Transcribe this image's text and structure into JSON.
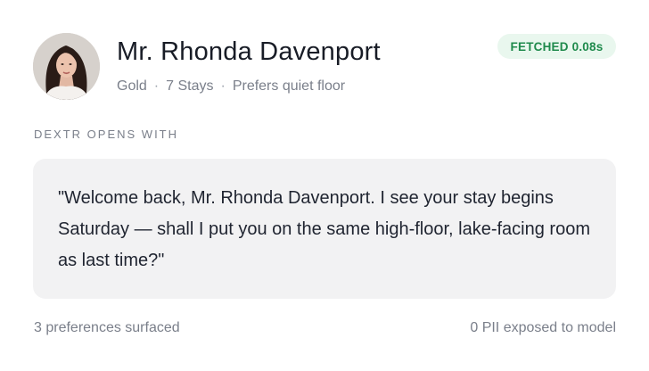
{
  "guest": {
    "name": "Mr. Rhonda Davenport",
    "tier": "Gold",
    "stays": "7 Stays",
    "preference": "Prefers quiet floor",
    "separator": "·",
    "avatar_icon": "guest-portrait"
  },
  "status": {
    "badge": "FETCHED 0.08s",
    "color": "#1f8a4c",
    "background": "#e9f7ee"
  },
  "opening": {
    "label": "DEXTR OPENS WITH",
    "message": "\"Welcome back, Mr. Rhonda Davenport. I see your stay begins Saturday — shall I put you on the same high-floor, lake-facing room as last time?\""
  },
  "footer": {
    "preferences": "3 preferences surfaced",
    "pii": "0 PII exposed to model"
  }
}
